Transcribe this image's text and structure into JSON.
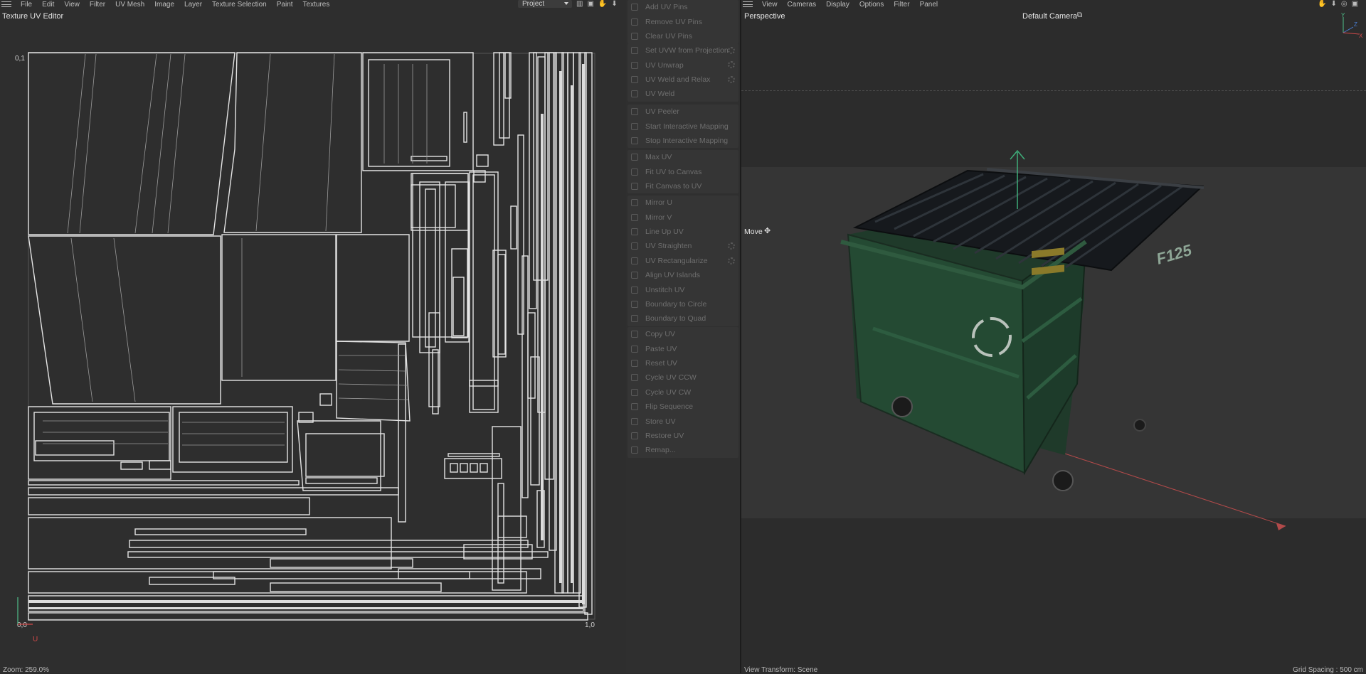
{
  "uv_menu": {
    "items": [
      "File",
      "Edit",
      "View",
      "Filter",
      "UV Mesh",
      "Image",
      "Layer",
      "Texture Selection",
      "Paint",
      "Textures"
    ],
    "project": "Project"
  },
  "uv_panel": {
    "title": "Texture UV Editor",
    "coord_tl": "0,1",
    "coord_bl": "0,0",
    "coord_br": "1,0",
    "axis_u": "U",
    "zoom": "Zoom: 259.0%"
  },
  "commands": {
    "groups": [
      [
        {
          "label": "Add UV Pins",
          "icon": "pin-icon"
        },
        {
          "label": "Remove UV Pins",
          "icon": "pin-remove-icon"
        },
        {
          "label": "Clear UV Pins",
          "icon": "close-icon"
        }
      ],
      [
        {
          "label": "Set UVW from Projection",
          "icon": "projection-icon",
          "gear": true
        },
        {
          "label": "UV Unwrap",
          "icon": "unwrap-icon",
          "gear": true
        },
        {
          "label": "UV Weld and Relax",
          "icon": "relax-icon",
          "gear": true
        },
        {
          "label": "UV Weld",
          "icon": "weld-icon"
        }
      ],
      [
        {
          "label": "UV Peeler",
          "icon": "peeler-icon"
        },
        {
          "label": "Start Interactive Mapping",
          "icon": "play-icon"
        },
        {
          "label": "Stop Interactive Mapping",
          "icon": "stop-icon"
        }
      ],
      [
        {
          "label": "Max UV",
          "icon": "max-icon"
        },
        {
          "label": "Fit UV to Canvas",
          "icon": "fit-icon"
        },
        {
          "label": "Fit Canvas to UV",
          "icon": "fit-canvas-icon"
        }
      ],
      [
        {
          "label": "Mirror U",
          "icon": "mirror-u-icon"
        },
        {
          "label": "Mirror V",
          "icon": "mirror-v-icon"
        },
        {
          "label": "Line Up UV",
          "icon": "lineup-icon"
        },
        {
          "label": "UV Straighten",
          "icon": "straighten-icon",
          "gear": true
        },
        {
          "label": "UV Rectangularize",
          "icon": "rectangularize-icon",
          "gear": true
        },
        {
          "label": "Align UV Islands",
          "icon": "align-icon"
        },
        {
          "label": "Unstitch UV",
          "icon": "unstitch-icon"
        },
        {
          "label": "Boundary to Circle",
          "icon": "circle-icon"
        },
        {
          "label": "Boundary to Quad",
          "icon": "quad-icon"
        }
      ],
      [
        {
          "label": "Copy UV",
          "icon": "copy-icon"
        },
        {
          "label": "Paste UV",
          "icon": "paste-icon"
        },
        {
          "label": "Reset UV",
          "icon": "reset-icon"
        },
        {
          "label": "Cycle UV CCW",
          "icon": "ccw-icon"
        },
        {
          "label": "Cycle UV CW",
          "icon": "cw-icon"
        },
        {
          "label": "Flip Sequence",
          "icon": "flip-icon"
        },
        {
          "label": "Store UV",
          "icon": "store-icon"
        },
        {
          "label": "Restore UV",
          "icon": "restore-icon"
        },
        {
          "label": "Remap...",
          "icon": "remap-icon"
        }
      ]
    ]
  },
  "viewport": {
    "menu": [
      "View",
      "Cameras",
      "Display",
      "Options",
      "Filter",
      "Panel"
    ],
    "perspective": "Perspective",
    "camera": "Default Camera",
    "move": "Move",
    "view_transform": "View Transform: Scene",
    "grid_spacing": "Grid Spacing : 500 cm",
    "dumpster_text": "F125",
    "axis_y": "Y",
    "axis_z": "Z",
    "axis_x": "X"
  }
}
